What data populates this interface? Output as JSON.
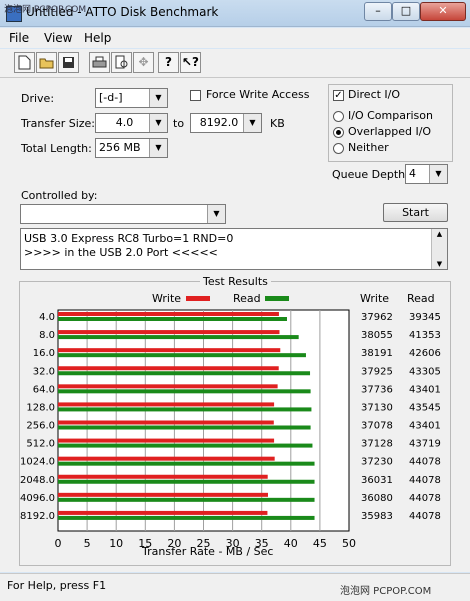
{
  "watermark": "泡泡网 PCPOP.COM",
  "window": {
    "title": "Untitled - ATTO Disk Benchmark",
    "minimize": "–",
    "maximize": "□",
    "close": "✕"
  },
  "menu": {
    "file": "File",
    "view": "View",
    "help": "Help"
  },
  "toolbar": {
    "new": "new-document-icon",
    "open": "open-folder-icon",
    "save": "save-disk-icon",
    "print": "printer-icon",
    "preview": "print-preview-icon",
    "move": "move-arrows-icon",
    "help": "question-icon",
    "context_help": "context-help-icon"
  },
  "drive": {
    "label": "Drive:",
    "value": "[-d-]"
  },
  "force_write": {
    "label": "Force Write Access",
    "checked": false
  },
  "direct_io": {
    "label": "Direct I/O",
    "checked": true
  },
  "transfer": {
    "label": "Transfer Size:",
    "from": "4.0",
    "to_label": "to",
    "to": "8192.0",
    "unit": "KB"
  },
  "total_length": {
    "label": "Total Length:",
    "value": "256 MB"
  },
  "io_mode": {
    "comparison": "I/O Comparison",
    "overlapped": "Overlapped I/O",
    "neither": "Neither",
    "selected": "Overlapped I/O"
  },
  "queue": {
    "label": "Queue Depth:",
    "value": "4"
  },
  "controlled_by": {
    "label": "Controlled by:",
    "value": ""
  },
  "start_button": "Start",
  "description": [
    "USB 3.0 Express RC8 Turbo=1 RND=0",
    ">>>> in the USB 2.0 Port <<<<<"
  ],
  "results": {
    "title": "Test Results",
    "write_legend": "Write",
    "read_legend": "Read",
    "write_header": "Write",
    "read_header": "Read",
    "xaxis_label": "Transfer Rate - MB / Sec"
  },
  "chart_data": {
    "type": "bar",
    "orientation": "horizontal",
    "title": "Test Results",
    "xlabel": "Transfer Rate - MB / Sec",
    "xlim": [
      0,
      50
    ],
    "xticks": [
      0,
      5,
      10,
      15,
      20,
      25,
      30,
      35,
      40,
      45,
      50
    ],
    "grid": true,
    "legend_placement": "top",
    "categories": [
      "4.0",
      "8.0",
      "16.0",
      "32.0",
      "64.0",
      "128.0",
      "256.0",
      "512.0",
      "1024.0",
      "2048.0",
      "4096.0",
      "8192.0"
    ],
    "series": [
      {
        "name": "Write",
        "color": "#e02020",
        "values": [
          37962,
          38055,
          38191,
          37925,
          37736,
          37130,
          37078,
          37128,
          37230,
          36031,
          36080,
          35983
        ]
      },
      {
        "name": "Read",
        "color": "#1a8a1a",
        "values": [
          39345,
          41353,
          42606,
          43305,
          43401,
          43545,
          43401,
          43719,
          44078,
          44078,
          44078,
          44078
        ]
      }
    ]
  },
  "status": "For Help, press F1",
  "footer_brand": "泡泡网 PCPOP.COM"
}
